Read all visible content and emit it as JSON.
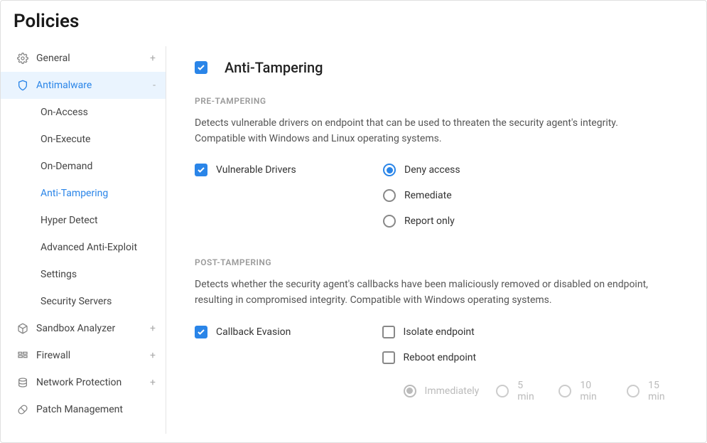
{
  "header": {
    "title": "Policies"
  },
  "sidebar": {
    "items": [
      {
        "label": "General",
        "expand": "+"
      },
      {
        "label": "Antimalware",
        "expand": "-"
      },
      {
        "label": "Sandbox Analyzer",
        "expand": "+"
      },
      {
        "label": "Firewall",
        "expand": "+"
      },
      {
        "label": "Network Protection",
        "expand": "+"
      },
      {
        "label": "Patch Management",
        "expand": ""
      }
    ],
    "sub": [
      "On-Access",
      "On-Execute",
      "On-Demand",
      "Anti-Tampering",
      "Hyper Detect",
      "Advanced Anti-Exploit",
      "Settings",
      "Security Servers"
    ]
  },
  "main": {
    "title": "Anti-Tampering",
    "pre": {
      "label": "PRE-TAMPERING",
      "desc": "Detects vulnerable drivers on endpoint that can be used to threaten the security agent's integrity. Compatible with Windows and Linux operating systems.",
      "option": "Vulnerable Drivers",
      "radios": [
        "Deny access",
        "Remediate",
        "Report only"
      ]
    },
    "post": {
      "label": "POST-TAMPERING",
      "desc": "Detects whether the security agent's callbacks have been maliciously removed or disabled on endpoint, resulting in compromised integrity. Compatible with Windows operating systems.",
      "option": "Callback Evasion",
      "checks": [
        "Isolate endpoint",
        "Reboot endpoint"
      ],
      "reboot_opts": [
        "Immediately",
        "5 min",
        "10 min",
        "15 min"
      ]
    }
  }
}
